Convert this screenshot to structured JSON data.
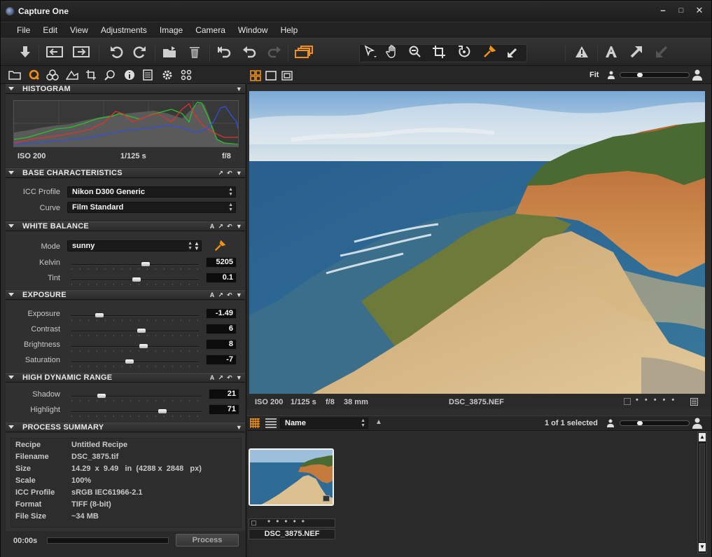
{
  "window": {
    "title": "Capture One"
  },
  "menu": [
    "File",
    "Edit",
    "View",
    "Adjustments",
    "Image",
    "Camera",
    "Window",
    "Help"
  ],
  "viewer": {
    "zoom_label": "Fit",
    "zoom_level": 0.25
  },
  "panels": {
    "histogram": {
      "title": "HISTOGRAM",
      "iso": "ISO 200",
      "shutter": "1/125 s",
      "aperture": "f/8"
    },
    "base": {
      "title": "BASE CHARACTERISTICS",
      "icc_label": "ICC Profile",
      "icc_value": "Nikon D300 Generic",
      "curve_label": "Curve",
      "curve_value": "Film Standard"
    },
    "wb": {
      "title": "WHITE BALANCE",
      "mode_label": "Mode",
      "mode_value": "sunny",
      "kelvin_label": "Kelvin",
      "kelvin_value": "5205",
      "kelvin_pos": 0.59,
      "tint_label": "Tint",
      "tint_value": "0.1",
      "tint_pos": 0.51
    },
    "exposure": {
      "title": "EXPOSURE",
      "rows": [
        {
          "label": "Exposure",
          "value": "-1.49",
          "pos": 0.2
        },
        {
          "label": "Contrast",
          "value": "6",
          "pos": 0.55
        },
        {
          "label": "Brightness",
          "value": "8",
          "pos": 0.57
        },
        {
          "label": "Saturation",
          "value": "-7",
          "pos": 0.45
        }
      ]
    },
    "hdr": {
      "title": "HIGH DYNAMIC RANGE",
      "rows": [
        {
          "label": "Shadow",
          "value": "21",
          "pos": 0.21
        },
        {
          "label": "Highlight",
          "value": "71",
          "pos": 0.71
        }
      ]
    },
    "process": {
      "title": "PROCESS SUMMARY",
      "rows": [
        {
          "label": "Recipe",
          "value": "Untitled Recipe"
        },
        {
          "label": "Filename",
          "value": "DSC_3875.tif"
        },
        {
          "label": "Size",
          "value": "14.29  x  9.49   in  (4288 x  2848   px)"
        },
        {
          "label": "Scale",
          "value": "100%"
        },
        {
          "label": "ICC Profile",
          "value": "sRGB IEC61966-2.1"
        },
        {
          "label": "Format",
          "value": "TIFF (8-bit)"
        },
        {
          "label": "File Size",
          "value": "~34 MB"
        }
      ],
      "time": "00:00s",
      "button": "Process"
    }
  },
  "image_info": {
    "iso": "ISO 200",
    "shutter": "1/125 s",
    "aperture": "f/8",
    "focal": "38 mm",
    "filename": "DSC_3875.NEF"
  },
  "browser": {
    "sort_label": "Name",
    "selection": "1 of 1 selected",
    "thumb_zoom": 0.25,
    "thumb_name": "DSC_3875.NEF"
  },
  "colors": {
    "accent": "#f0921a",
    "histogram_bg": "#383838"
  }
}
